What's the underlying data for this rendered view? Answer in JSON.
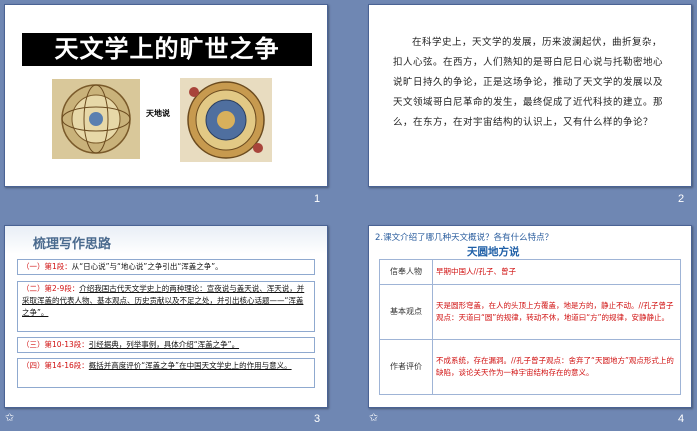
{
  "slides": [
    {
      "number": "1",
      "title": "天文学上的旷世之争",
      "versus_label": "天地说"
    },
    {
      "number": "2",
      "paragraph": "在科学史上，天文学的发展，历来波澜起伏，曲折复杂，扣人心弦。在西方，人们熟知的是哥白尼日心说与托勒密地心说旷日持久的争论，正是这场争论，推动了天文学的发展以及天文领域哥白尼革命的发生，最终促成了近代科技的建立。那么，在东方，在对宇宙结构的认识上，又有什么样的争论？"
    },
    {
      "number": "3",
      "title": "梳理写作思路",
      "rows": [
        {
          "label": "（一）第1段：",
          "text": "从“日心说”与“地心说”之争引出“浑盖之争”。"
        },
        {
          "label": "（二）第2-9段：",
          "text": "介绍我国古代天文学史上的两种理论：宣夜说与盖天说、浑天说，并采取浑盖的代表人物、基本观点、历史贡献以及不足之处，并引出核心话题——“浑盖之争”。"
        },
        {
          "label": "（三）第10-13段：",
          "text": "引经据典，列举事例，具体介绍“浑盖之争”。"
        },
        {
          "label": "（四）第14-16段：",
          "text": "概括并高度评价“浑盖之争”在中国天文学史上的作用与意义。"
        }
      ]
    },
    {
      "number": "4",
      "question": "2.课文介绍了哪几种天文概说？各有什么特点？",
      "heading": "天圆地方说",
      "table": [
        {
          "key": "信奉人物",
          "value": "早期中国人//孔子、曾子"
        },
        {
          "key": "基本观点",
          "value": "天是圆形穹盖，在人的头顶上方覆盖，地是方的，静止不动。//孔子曾子观点：天道曰“圆”的规律，转动不休，地道曰“方”的规律，安静静止。"
        },
        {
          "key": "作者评价",
          "value": "不成系统，存在漏洞。//孔子曾子观点：舍弃了“天圆地方”观点形式上的缺陷，谈论关天作为一种宇宙结构存在的意义。"
        }
      ]
    }
  ]
}
